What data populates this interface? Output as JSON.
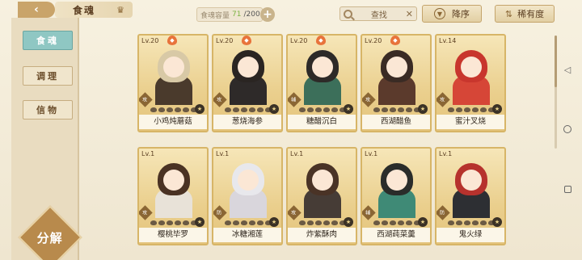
{
  "header": {
    "back_icon": "back-arrow-icon",
    "title": "食魂",
    "crown_icon": "crown-icon",
    "capacity_label": "食魂容量",
    "capacity_used": "71",
    "capacity_total": "/200",
    "add_label": "+",
    "search_placeholder": "查找",
    "sort_label": "降序",
    "rarity_label": "稀有度"
  },
  "sidebar": {
    "items": [
      {
        "label": "食魂",
        "active": true
      },
      {
        "label": "调理",
        "active": false
      },
      {
        "label": "信物",
        "active": false
      }
    ],
    "decompose_label": "分解"
  },
  "cards": [
    {
      "level": "Lv.20",
      "name": "小鸡炖蘑菇",
      "attr": "攻",
      "hair": "#d8c9a6",
      "outfit": "#4a3a2c",
      "flame": true
    },
    {
      "level": "Lv.20",
      "name": "葱烧海参",
      "attr": "攻",
      "hair": "#2a2522",
      "outfit": "#2e2a29",
      "flame": true
    },
    {
      "level": "Lv.20",
      "name": "糖醋沉白",
      "attr": "辅",
      "hair": "#2d2a28",
      "outfit": "#3c6f5a",
      "flame": true
    },
    {
      "level": "Lv.20",
      "name": "西湖醋鱼",
      "attr": "攻",
      "hair": "#3a2b24",
      "outfit": "#5b3a2c",
      "flame": true
    },
    {
      "level": "Lv.14",
      "name": "蜜汁叉烧",
      "attr": "攻",
      "hair": "#c8362d",
      "outfit": "#d64637",
      "flame": false
    },
    {
      "level": "Lv.1",
      "name": "樱桃毕罗",
      "attr": "攻",
      "hair": "#4a3223",
      "outfit": "#e8e2d8",
      "flame": false
    },
    {
      "level": "Lv.1",
      "name": "冰糖湘莲",
      "attr": "防",
      "hair": "#e8e8ec",
      "outfit": "#d9d6dc",
      "flame": false
    },
    {
      "level": "Lv.1",
      "name": "炸紫酥肉",
      "attr": "攻",
      "hair": "#4a3326",
      "outfit": "#463c36",
      "flame": false
    },
    {
      "level": "Lv.1",
      "name": "西湖莼菜羹",
      "attr": "辅",
      "hair": "#2a2c2a",
      "outfit": "#3f8a76",
      "flame": false
    },
    {
      "level": "Lv.1",
      "name": "鬼火绿",
      "attr": "防",
      "hair": "#b6322d",
      "outfit": "#2d2f33",
      "flame": false
    }
  ],
  "colors": {
    "accent": "#c9a46a",
    "active_tab": "#8fc7c3",
    "card_border": "#d7b567"
  },
  "icons": {
    "search": "search-icon",
    "clear": "close-icon",
    "sort": "sort-icon",
    "filter": "filter-icon",
    "star": "star-icon",
    "flame": "flame-icon"
  }
}
